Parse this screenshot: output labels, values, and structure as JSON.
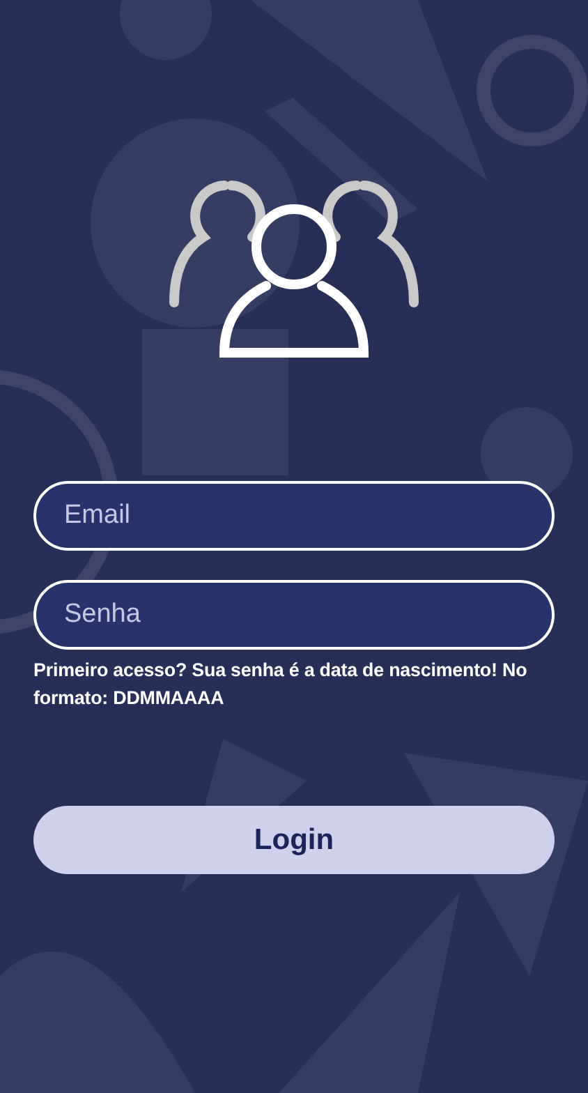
{
  "form": {
    "fields": [
      {
        "placeholder": "Email"
      },
      {
        "placeholder": "Senha"
      }
    ],
    "hint": "Primeiro acesso? Sua senha é a data de nascimento! No formato: DDMMAAAA",
    "button": "Login"
  }
}
